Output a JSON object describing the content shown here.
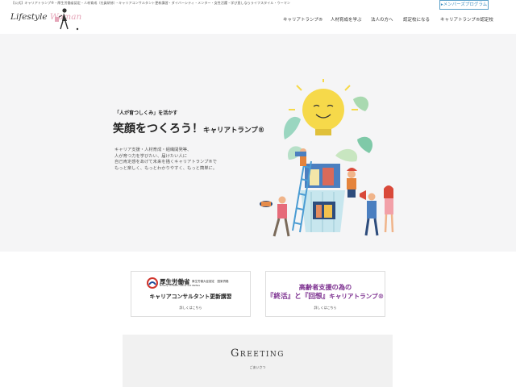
{
  "top_strip": {
    "text": "【公式】キャリアトランプ®・厚生労働省認定・人材育成（社員研修）・キャリアコンサルタント更新講習・ダイバーシティ・メンター・女性活躍・学び直しならライフスタイル・ウーマン"
  },
  "header": {
    "logo_text_1": "Lifestyle ",
    "logo_text_2": "Woman",
    "member_button": "▸メンバーズプログラム"
  },
  "nav": {
    "items": [
      {
        "label": "キャリアトランプ®"
      },
      {
        "label": "人材育成を学ぶ"
      },
      {
        "label": "法人の方へ"
      },
      {
        "label": "認定校になる"
      },
      {
        "label": "キャリアトランプ®認定校"
      }
    ]
  },
  "hero": {
    "subtitle": "「人が育つしくみ」を活かす",
    "title_main": "笑顔をつくろう！",
    "title_small": "キャリアトランプ®",
    "lines": [
      "キャリア支援・人材育成・組織開発等、",
      "人が育つ力を学びたい、届けたい人に",
      "自己肯定感をあげて未来を描くキャリアトランプ®で",
      "もっと楽しく、もっとわかりやすく、もっと簡単に。"
    ]
  },
  "banners": {
    "mhlw": {
      "name": "厚生労働省",
      "name_en": "Ministry of Health, Labour and Welfare",
      "note": "厚生労働大臣認定　国家資格",
      "title": "キャリアコンサルタント更新講習",
      "link": "詳しくはこちら"
    },
    "shukatsu": {
      "line1": "高齢者支援の為の",
      "line2_a": "『終活』と『回想』",
      "line2_b": "キャリアトランプ®",
      "link": "詳しくはこちら"
    }
  },
  "greeting": {
    "title": "Greeting",
    "subtitle": "ごあいさつ"
  },
  "colors": {
    "accent_blue": "#3d8dbf",
    "hero_bg": "#f5f5f6",
    "banner_purple": "#7c2f8f",
    "bulb_yellow": "#f6d94a",
    "logo_pink": "#e5a5b8"
  }
}
